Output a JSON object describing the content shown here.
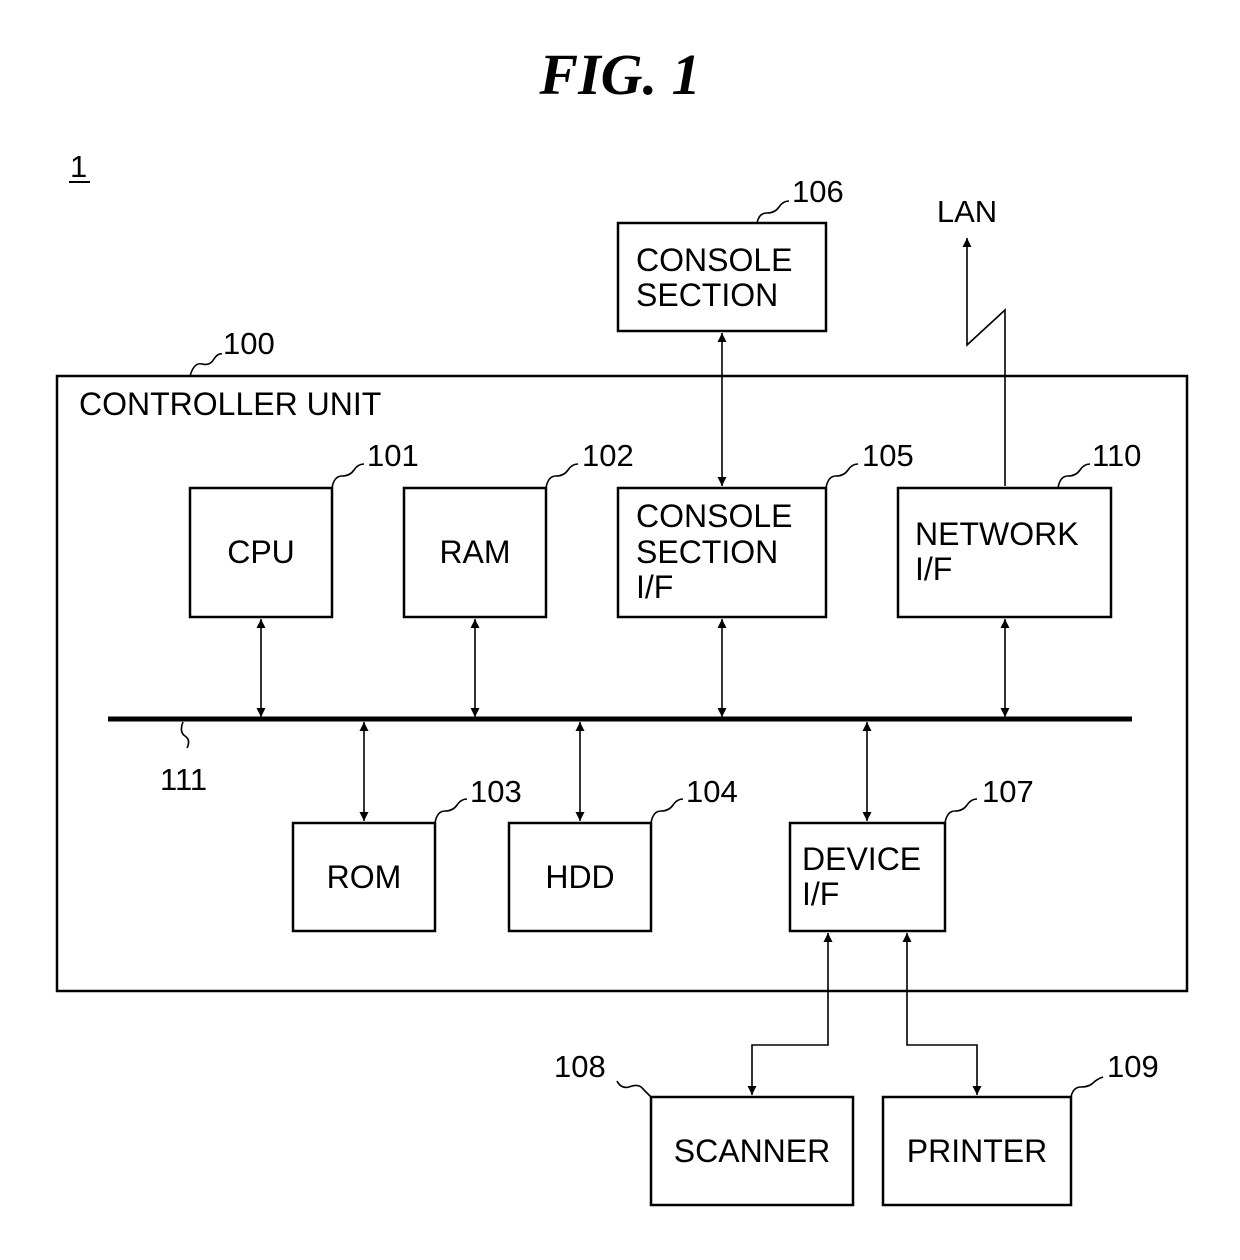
{
  "title": "FIG. 1",
  "system_ref": "1",
  "lan_label": "LAN",
  "controller": {
    "ref": "100",
    "label": "CONTROLLER UNIT"
  },
  "bus": {
    "ref": "111"
  },
  "blocks": {
    "cpu": {
      "ref": "101",
      "lines": [
        "CPU"
      ]
    },
    "ram": {
      "ref": "102",
      "lines": [
        "RAM"
      ]
    },
    "console_if": {
      "ref": "105",
      "lines": [
        "CONSOLE",
        "SECTION",
        "I/F"
      ]
    },
    "network_if": {
      "ref": "110",
      "lines": [
        "NETWORK",
        "I/F"
      ]
    },
    "rom": {
      "ref": "103",
      "lines": [
        "ROM"
      ]
    },
    "hdd": {
      "ref": "104",
      "lines": [
        "HDD"
      ]
    },
    "device_if": {
      "ref": "107",
      "lines": [
        "DEVICE",
        "I/F"
      ]
    },
    "console": {
      "ref": "106",
      "lines": [
        "CONSOLE",
        "SECTION"
      ]
    },
    "scanner": {
      "ref": "108",
      "lines": [
        "SCANNER"
      ]
    },
    "printer": {
      "ref": "109",
      "lines": [
        "PRINTER"
      ]
    }
  }
}
